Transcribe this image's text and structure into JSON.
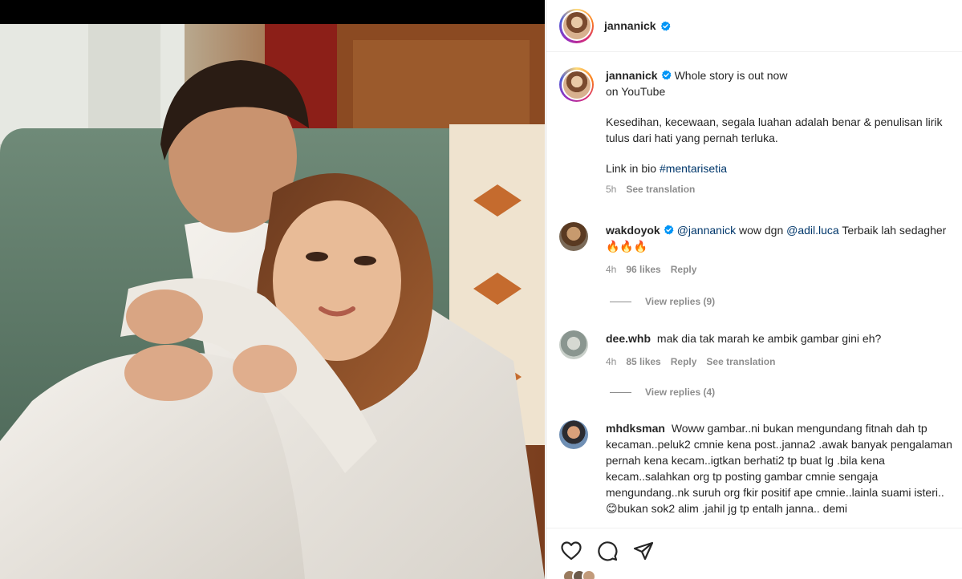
{
  "post": {
    "author": "jannanick",
    "verified": true
  },
  "caption": {
    "username": "jannanick",
    "line1": "Whole story is out now",
    "line2": "on YouTube",
    "paragraph2": "Kesedihan, kecewaan, segala luahan adalah benar & penulisan lirik tulus dari hati yang pernah terluka.",
    "paragraph3_prefix": "Link in bio",
    "hashtag": "#mentarisetia",
    "time": "5h",
    "see_translation": "See translation"
  },
  "comments": [
    {
      "username": "wakdoyok",
      "verified": true,
      "mention1": "@jannanick",
      "text1": "wow dgn",
      "mention2": "@adil.luca",
      "text2": "Terbaik lah sedagher",
      "emoji": "🔥🔥🔥",
      "time": "4h",
      "likes": "96 likes",
      "reply": "Reply",
      "view_replies": "View replies (9)"
    },
    {
      "username": "dee.whb",
      "text": "mak dia tak marah ke ambik gambar gini eh?",
      "time": "4h",
      "likes": "85 likes",
      "reply": "Reply",
      "see_translation": "See translation",
      "view_replies": "View replies (4)"
    },
    {
      "username": "mhdksman",
      "text_a": "Woww gambar..ni bukan mengundang fitnah dah tp kecaman..peluk2 cmnie kena post..janna2 .awak banyak pengalaman pernah kena kecam..igtkan berhati2 tp buat lg .bila kena kecam..salahkan org tp posting gambar cmnie sengaja mengundang..nk suruh org fkir positif ape cmnie..lainla suami isteri..",
      "emoji": "😊",
      "text_b": "bukan sok2 alim .jahil jg tp entalh janna.. demi"
    }
  ],
  "actions": {
    "like_icon": "heart-icon",
    "comment_icon": "comment-bubble-icon",
    "share_icon": "paper-plane-icon"
  },
  "colors": {
    "verified_blue": "#0095f6",
    "link_blue": "#00376b",
    "muted_gray": "#8e8e8e"
  }
}
